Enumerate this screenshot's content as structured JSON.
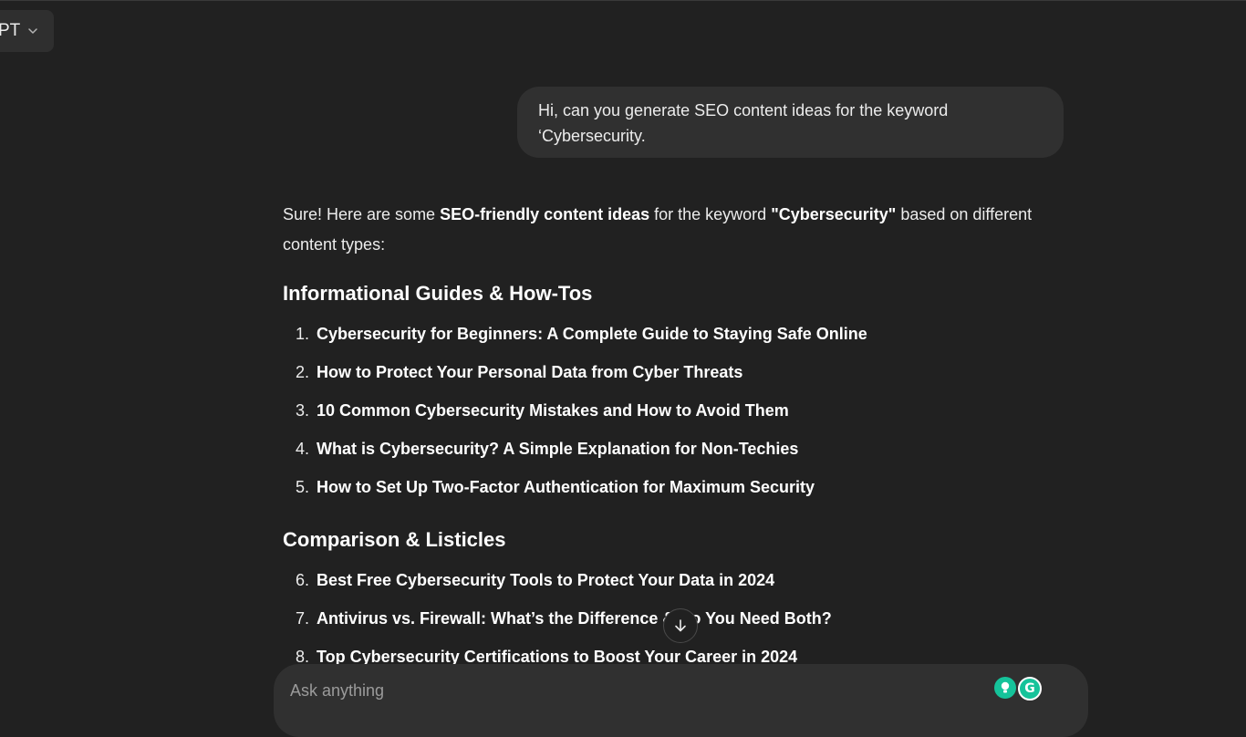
{
  "header": {
    "model_label": "PT"
  },
  "user_message": {
    "line1": "Hi, can you generate SEO content ideas for the keyword",
    "line2": "‘Cybersecurity."
  },
  "assistant": {
    "intro_part1": "Sure! Here are some ",
    "intro_bold1": "SEO-friendly content ideas",
    "intro_part2": " for the keyword ",
    "intro_bold2": "\"Cybersecurity\"",
    "intro_part3": " based on different content types:",
    "sections": [
      {
        "heading": "Informational Guides & How-Tos",
        "items": [
          {
            "num": "1.",
            "text": "Cybersecurity for Beginners: A Complete Guide to Staying Safe Online"
          },
          {
            "num": "2.",
            "text": "How to Protect Your Personal Data from Cyber Threats"
          },
          {
            "num": "3.",
            "text": "10 Common Cybersecurity Mistakes and How to Avoid Them"
          },
          {
            "num": "4.",
            "text": "What is Cybersecurity? A Simple Explanation for Non-Techies"
          },
          {
            "num": "5.",
            "text": "How to Set Up Two-Factor Authentication for Maximum Security"
          }
        ]
      },
      {
        "heading": "Comparison & Listicles",
        "items": [
          {
            "num": "6.",
            "text": "Best Free Cybersecurity Tools to Protect Your Data in 2024"
          },
          {
            "num": "7.",
            "text": "Antivirus vs. Firewall: What’s the Difference & Do You Need Both?"
          },
          {
            "num": "8.",
            "text": "Top Cybersecurity Certifications to Boost Your Career in 2024"
          }
        ]
      }
    ]
  },
  "composer": {
    "placeholder": "Ask anything",
    "grammarly_letter": "G"
  },
  "icons": {
    "model_dropdown": "chevron-down-icon",
    "scroll": "arrow-down-icon",
    "bulb": "lightbulb-icon",
    "grammarly": "grammarly-icon"
  },
  "colors": {
    "background": "#212121",
    "bubble": "#303030",
    "grammarly_green": "#15c39a"
  }
}
